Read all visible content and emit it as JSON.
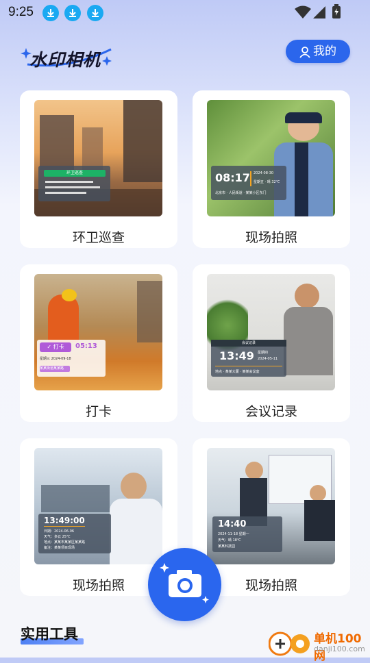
{
  "status_bar": {
    "time": "9:25"
  },
  "header": {
    "logo_text": "水印相机",
    "mine_label": "我的"
  },
  "cards": [
    {
      "label": "环卫巡查",
      "wm_title": "环卫巡查"
    },
    {
      "label": "现场拍照",
      "wm_time": "08:17",
      "wm_date": "2024-08-30",
      "wm_weekday": "星期五 · 晴 32℃",
      "wm_loc": "北京市 · 人民街道 · 某某小区东门"
    },
    {
      "label": "打卡",
      "wm_tag": "打卡",
      "wm_time": "05:13",
      "wm_date": "星期三 2024-09-18",
      "wm_loc": "某某街道某某路"
    },
    {
      "label": "会议记录",
      "wm_title": "会议记录",
      "wm_time": "13:49",
      "wm_weekday": "星期四",
      "wm_date": "2024-05-11",
      "wm_loc": "地点 · 某某大厦 · 某某会议室"
    },
    {
      "label": "现场拍照",
      "wm_time": "13:49:00",
      "wm_lines": [
        "日期：2024-06-06",
        "天气：多云 25℃",
        "地点：某某市某某区某某路",
        "备注：某某项目现场"
      ]
    },
    {
      "label": "现场拍照",
      "wm_time": "14:40",
      "wm_date": "2024-11-18 星期一",
      "wm_weather": "天气：晴 18℃",
      "wm_loc": "某某科技园"
    }
  ],
  "section": {
    "title": "实用工具"
  },
  "brand": {
    "name": "单机100网",
    "url": "danji100.com"
  }
}
